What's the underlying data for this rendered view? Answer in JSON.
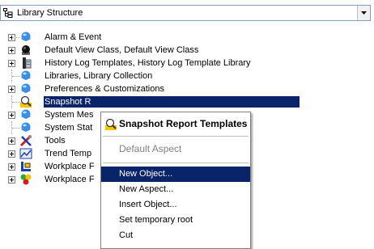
{
  "header": {
    "dropdown_label": "Library Structure"
  },
  "tree": {
    "items": [
      {
        "label": "Alarm & Event",
        "icon": "sphere-icon"
      },
      {
        "label": "Default View Class, Default View Class",
        "icon": "black-sphere-icon"
      },
      {
        "label": "History Log Templates, History Log Template Library",
        "icon": "history-log-icon"
      },
      {
        "label": "Libraries, Library Collection",
        "icon": "sphere-icon"
      },
      {
        "label": "Preferences & Customizations",
        "icon": "sphere-icon"
      },
      {
        "label": "Snapshot R",
        "icon": "snapshot-report-icon"
      },
      {
        "label": "System Mes",
        "icon": "sphere-icon"
      },
      {
        "label": "System Stat",
        "icon": "sphere-icon"
      },
      {
        "label": "Tools",
        "icon": "tools-icon"
      },
      {
        "label": "Trend Temp",
        "icon": "trend-icon"
      },
      {
        "label": "Workplace F",
        "icon": "workplace-icon"
      },
      {
        "label": "Workplace F",
        "icon": "workplace-plugin-icon"
      }
    ]
  },
  "context_menu": {
    "title": "Snapshot Report Templates",
    "default_aspect": "Default Aspect",
    "items": [
      {
        "label": "New Object..."
      },
      {
        "label": "New Aspect..."
      },
      {
        "label": "Insert Object..."
      },
      {
        "label": "Set temporary root"
      },
      {
        "label": "Cut"
      }
    ]
  },
  "colors": {
    "selection": "#0a246a",
    "sphere_blue": "#3a8ee6"
  }
}
